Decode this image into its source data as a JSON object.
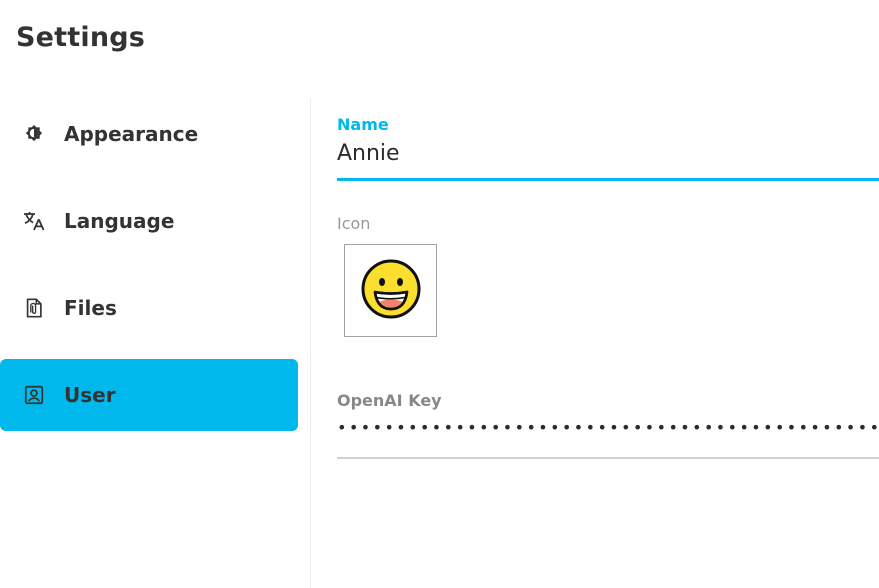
{
  "page": {
    "title": "Settings"
  },
  "sidebar": {
    "items": [
      {
        "label": "Appearance",
        "icon": "brightness-icon",
        "active": false
      },
      {
        "label": "Language",
        "icon": "translate-icon",
        "active": false
      },
      {
        "label": "Files",
        "icon": "file-attachment-icon",
        "active": false
      },
      {
        "label": "User",
        "icon": "account-box-icon",
        "active": true
      }
    ]
  },
  "user": {
    "name_label": "Name",
    "name_value": "Annie",
    "icon_label": "Icon",
    "icon": "grinning-face-icon",
    "openai_key_label": "OpenAI Key",
    "openai_key_masked": "••••••••••••••••••••••••••••••••••••••••••••••••••••••••••"
  },
  "colors": {
    "accent": "#00b8eb",
    "text": "#333333",
    "muted": "#9a9a9a"
  }
}
